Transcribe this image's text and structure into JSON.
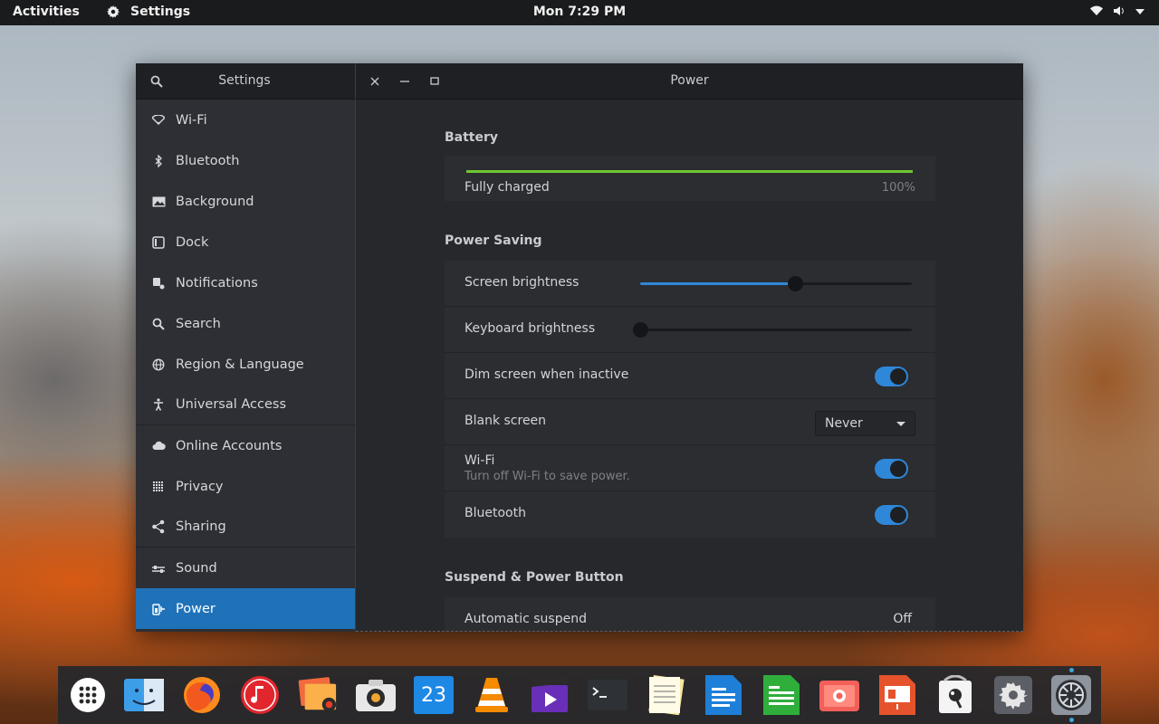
{
  "topbar": {
    "activities": "Activities",
    "app_name": "Settings",
    "clock": "Mon  7:29 PM"
  },
  "window": {
    "sidebar_title": "Settings",
    "panel_title": "Power"
  },
  "sidebar": {
    "items": [
      {
        "label": "Wi-Fi",
        "icon": "wifi-icon"
      },
      {
        "label": "Bluetooth",
        "icon": "bluetooth-icon"
      },
      {
        "label": "Background",
        "icon": "image-icon"
      },
      {
        "label": "Dock",
        "icon": "dock-icon"
      },
      {
        "label": "Notifications",
        "icon": "bell-icon"
      },
      {
        "label": "Search",
        "icon": "search-icon"
      },
      {
        "label": "Region & Language",
        "icon": "globe-icon"
      },
      {
        "label": "Universal Access",
        "icon": "accessibility-icon"
      },
      {
        "label": "Online Accounts",
        "icon": "cloud-icon"
      },
      {
        "label": "Privacy",
        "icon": "privacy-icon"
      },
      {
        "label": "Sharing",
        "icon": "share-icon"
      },
      {
        "label": "Sound",
        "icon": "sound-icon"
      },
      {
        "label": "Power",
        "icon": "power-icon",
        "active": true
      }
    ]
  },
  "battery": {
    "title": "Battery",
    "status": "Fully charged",
    "percent_text": "100%",
    "level": 1.0
  },
  "power_saving": {
    "title": "Power Saving",
    "screen_brightness_label": "Screen brightness",
    "screen_brightness_level": 0.57,
    "keyboard_brightness_label": "Keyboard brightness",
    "keyboard_brightness_level": 0.0,
    "dim_screen_label": "Dim screen when inactive",
    "dim_screen_on": true,
    "blank_screen_label": "Blank screen",
    "blank_screen_value": "Never",
    "wifi_label": "Wi-Fi",
    "wifi_sub": "Turn off Wi-Fi to save power.",
    "wifi_on": true,
    "bluetooth_label": "Bluetooth",
    "bluetooth_on": true
  },
  "suspend": {
    "title": "Suspend & Power Button",
    "automatic_suspend_label": "Automatic suspend",
    "automatic_suspend_value": "Off"
  },
  "dock": {
    "calendar_day": "23"
  },
  "colors": {
    "accent": "#1f72b8",
    "toggle_on": "#2f87d8",
    "battery_fill": "#6ec630"
  }
}
